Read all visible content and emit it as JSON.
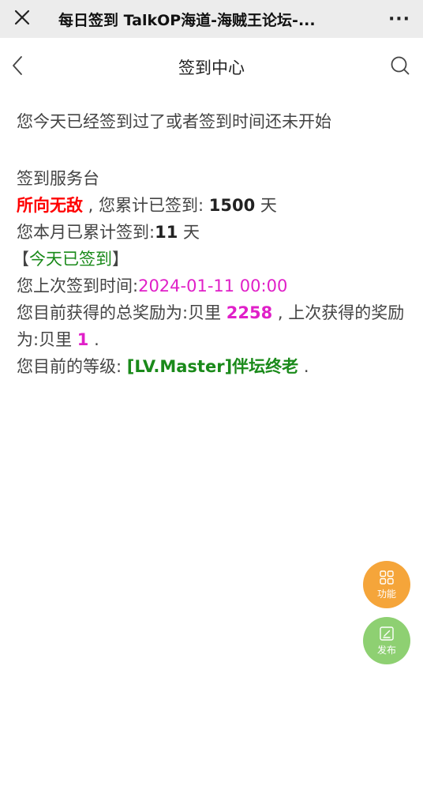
{
  "topbar": {
    "title": "每日签到 TalkOP海道-海贼王论坛-...",
    "close_icon": "close-icon",
    "more_label": "···"
  },
  "header": {
    "title": "签到中心",
    "back_icon": "chevron-left-icon",
    "search_icon": "search-icon"
  },
  "content": {
    "notice": "您今天已经签到过了或者签到时间还未开始",
    "section_title": "签到服务台",
    "user_title": "所向无敌",
    "total_prefix": " , 您累计已签到: ",
    "total_days": "1500",
    "total_suffix": " 天",
    "month_prefix": "您本月已累计签到:",
    "month_days": "11",
    "month_suffix": " 天",
    "status_open": "【",
    "status_text": "今天已签到",
    "status_close": "】",
    "last_time_label": "您上次签到时间:",
    "last_time_value": "2024-01-11 00:00",
    "reward_prefix": "您目前获得的总奖励为:贝里 ",
    "reward_total": "2258",
    "reward_mid": " , 上次获得的奖励为:贝里 ",
    "reward_last": "1",
    "reward_suffix": " .",
    "level_prefix": "您目前的等级: ",
    "level_value": "[LV.Master]伴坛终老",
    "level_suffix": " ."
  },
  "fabs": {
    "func_label": "功能",
    "post_label": "发布"
  },
  "colors": {
    "red": "#ff0000",
    "green": "#1a8a1a",
    "magenta": "#e020c8",
    "fab_orange": "#f5a53a",
    "fab_green": "#8ed072"
  }
}
